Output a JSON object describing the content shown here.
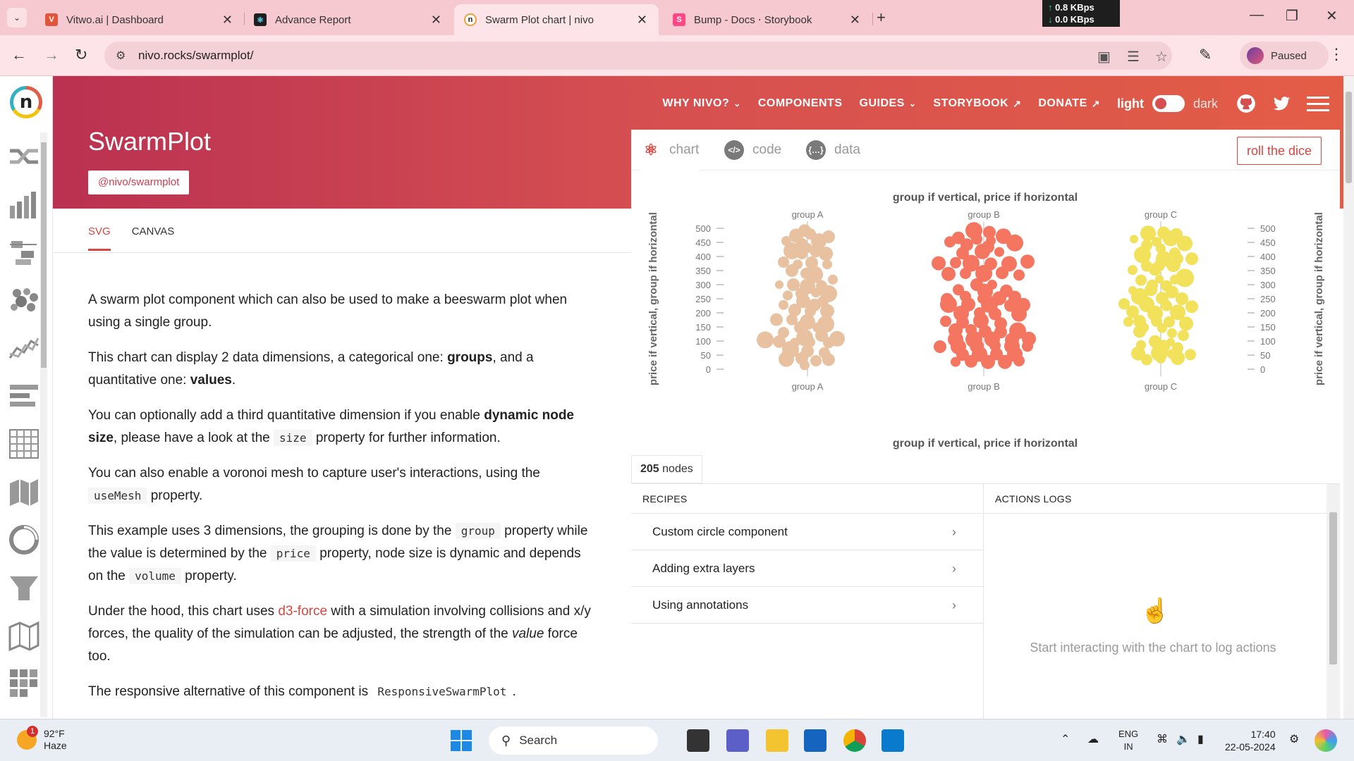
{
  "browser": {
    "tabs": [
      {
        "title": "Vitwo.ai | Dashboard",
        "favicon": "vitwo-icon",
        "color": "#e2553b"
      },
      {
        "title": "Advance Report",
        "favicon": "react-icon",
        "color": "#1f1f1f"
      },
      {
        "title": "Swarm Plot chart | nivo",
        "favicon": "nivo-icon",
        "color": "#e8a33a"
      },
      {
        "title": "Bump - Docs ⋅ Storybook",
        "favicon": "storybook-icon",
        "color": "#ff4785"
      }
    ],
    "active_tab": 2,
    "net_up": "0.8 KBps",
    "net_down": "0.0 KBps",
    "url": "nivo.rocks/swarmplot/",
    "profile_status": "Paused"
  },
  "header": {
    "title": "SwarmPlot",
    "package": "@nivo/swarmplot",
    "nav": [
      {
        "label": "WHY NIVO?",
        "kind": "dropdown"
      },
      {
        "label": "COMPONENTS",
        "kind": "link"
      },
      {
        "label": "GUIDES",
        "kind": "dropdown"
      },
      {
        "label": "STORYBOOK",
        "kind": "external"
      },
      {
        "label": "DONATE",
        "kind": "external"
      }
    ],
    "theme_light": "light",
    "theme_dark": "dark"
  },
  "subtabs": [
    "SVG",
    "CANVAS"
  ],
  "description": {
    "p1": "A swarm plot component which can also be used to make a beeswarm plot when using a single group.",
    "p2a": "This chart can display 2 data dimensions, a categorical one: ",
    "p2b": "groups",
    "p2c": ", and a quantitative one: ",
    "p2d": "values",
    "p2e": ".",
    "p3a": "You can optionally add a third quantitative dimension if you enable ",
    "p3b": "dynamic node size",
    "p3c": ", please have a look at the ",
    "p3d": "size",
    "p3e": " property for further information.",
    "p4a": "You can also enable a voronoi mesh to capture user's interactions, using the ",
    "p4b": "useMesh",
    "p4c": " property.",
    "p5a": "This example uses 3 dimensions, the grouping is done by the ",
    "p5b": "group",
    "p5c": " property while the value is determined by the ",
    "p5d": "price",
    "p5e": " property, node size is dynamic and depends on the ",
    "p5f": "volume",
    "p5g": " property.",
    "p6a": "Under the hood, this chart uses ",
    "p6b": "d3-force",
    "p6c": " with a simulation involving collisions and x/y forces, the quality of the simulation can be adjusted, the strength of the ",
    "p6d": "value",
    "p6e": " force too.",
    "p7a": "The responsive alternative of this component is ",
    "p7b": "ResponsiveSwarmPlot",
    "p7c": "."
  },
  "panel": {
    "tabs": [
      "chart",
      "code",
      "data"
    ],
    "dice": "roll the dice",
    "nodes_count": "205",
    "nodes_label": "nodes"
  },
  "recipes": {
    "heading": "RECIPES",
    "items": [
      "Custom circle component",
      "Adding extra layers",
      "Using annotations"
    ]
  },
  "logs": {
    "heading": "ACTIONS LOGS",
    "empty": "Start interacting with the chart to log actions"
  },
  "chart_data": {
    "type": "scatter",
    "title": "group if vertical, price if horizontal",
    "xlabel": "group if vertical, price if horizontal",
    "ylabel": "price if vertical, group if horizontal",
    "categories": [
      "group A",
      "group B",
      "group C"
    ],
    "y_ticks": [
      0,
      50,
      100,
      150,
      200,
      250,
      300,
      350,
      400,
      450,
      500
    ],
    "ylim": [
      0,
      500
    ],
    "colors": [
      "#e8c1a0",
      "#f47560",
      "#f1e15b"
    ],
    "grid": false,
    "series": [
      {
        "name": "group A",
        "nodes": [
          [
            -4,
            492,
            9
          ],
          [
            -16,
            474,
            10
          ],
          [
            4,
            480,
            8
          ],
          [
            -30,
            455,
            7
          ],
          [
            16,
            455,
            11
          ],
          [
            -8,
            446,
            8
          ],
          [
            30,
            470,
            9
          ],
          [
            0,
            430,
            7
          ],
          [
            -22,
            420,
            12
          ],
          [
            12,
            420,
            9
          ],
          [
            -8,
            410,
            8
          ],
          [
            26,
            410,
            10
          ],
          [
            -34,
            380,
            8
          ],
          [
            -14,
            372,
            7
          ],
          [
            6,
            378,
            9
          ],
          [
            28,
            372,
            7
          ],
          [
            -22,
            350,
            9
          ],
          [
            10,
            336,
            12
          ],
          [
            -2,
            340,
            8
          ],
          [
            36,
            318,
            7
          ],
          [
            -40,
            300,
            6
          ],
          [
            -20,
            300,
            9
          ],
          [
            0,
            294,
            11
          ],
          [
            20,
            296,
            8
          ],
          [
            -8,
            268,
            9
          ],
          [
            12,
            272,
            7
          ],
          [
            30,
            268,
            12
          ],
          [
            -28,
            262,
            7
          ],
          [
            -6,
            242,
            10
          ],
          [
            22,
            240,
            8
          ],
          [
            -34,
            228,
            7
          ],
          [
            10,
            228,
            9
          ],
          [
            -18,
            210,
            9
          ],
          [
            4,
            206,
            8
          ],
          [
            28,
            206,
            10
          ],
          [
            -44,
            176,
            9
          ],
          [
            -22,
            176,
            8
          ],
          [
            0,
            168,
            11
          ],
          [
            26,
            160,
            12
          ],
          [
            -10,
            148,
            9
          ],
          [
            14,
            148,
            7
          ],
          [
            -34,
            130,
            8
          ],
          [
            -4,
            112,
            12
          ],
          [
            20,
            120,
            9
          ],
          [
            42,
            108,
            11
          ],
          [
            -60,
            104,
            12
          ],
          [
            -40,
            98,
            9
          ],
          [
            -18,
            94,
            7
          ],
          [
            4,
            96,
            7
          ],
          [
            30,
            94,
            8
          ],
          [
            -24,
            70,
            12
          ],
          [
            0,
            64,
            9
          ],
          [
            24,
            58,
            8
          ],
          [
            -30,
            36,
            11
          ],
          [
            -8,
            38,
            9
          ],
          [
            12,
            30,
            8
          ],
          [
            30,
            34,
            9
          ],
          [
            -4,
            14,
            7
          ]
        ]
      },
      {
        "name": "group B",
        "nodes": [
          [
            -14,
            492,
            12
          ],
          [
            8,
            486,
            9
          ],
          [
            28,
            472,
            11
          ],
          [
            -36,
            466,
            9
          ],
          [
            -10,
            462,
            8
          ],
          [
            10,
            456,
            7
          ],
          [
            44,
            448,
            12
          ],
          [
            -48,
            452,
            8
          ],
          [
            -24,
            442,
            9
          ],
          [
            6,
            434,
            9
          ],
          [
            -2,
            418,
            11
          ],
          [
            -30,
            412,
            9
          ],
          [
            22,
            416,
            7
          ],
          [
            -64,
            376,
            10
          ],
          [
            -40,
            378,
            8
          ],
          [
            -18,
            376,
            12
          ],
          [
            10,
            374,
            9
          ],
          [
            36,
            374,
            11
          ],
          [
            62,
            382,
            10
          ],
          [
            -50,
            338,
            10
          ],
          [
            -26,
            340,
            8
          ],
          [
            0,
            340,
            12
          ],
          [
            26,
            342,
            9
          ],
          [
            50,
            334,
            8
          ],
          [
            -10,
            300,
            9
          ],
          [
            12,
            300,
            7
          ],
          [
            -36,
            282,
            8
          ],
          [
            2,
            276,
            11
          ],
          [
            32,
            278,
            9
          ],
          [
            -52,
            248,
            9
          ],
          [
            -26,
            258,
            8
          ],
          [
            -2,
            250,
            7
          ],
          [
            22,
            252,
            10
          ],
          [
            44,
            256,
            9
          ],
          [
            -50,
            230,
            12
          ],
          [
            -22,
            230,
            10
          ],
          [
            8,
            230,
            12
          ],
          [
            38,
            226,
            9
          ],
          [
            56,
            228,
            10
          ],
          [
            -32,
            198,
            11
          ],
          [
            -6,
            200,
            8
          ],
          [
            16,
            196,
            9
          ],
          [
            50,
            196,
            11
          ],
          [
            -54,
            170,
            8
          ],
          [
            -30,
            166,
            9
          ],
          [
            -4,
            172,
            11
          ],
          [
            24,
            162,
            9
          ],
          [
            -40,
            138,
            10
          ],
          [
            -18,
            140,
            8
          ],
          [
            2,
            134,
            9
          ],
          [
            24,
            132,
            9
          ],
          [
            48,
            136,
            12
          ],
          [
            -40,
            106,
            11
          ],
          [
            -14,
            106,
            12
          ],
          [
            12,
            106,
            11
          ],
          [
            40,
            104,
            10
          ],
          [
            64,
            108,
            10
          ],
          [
            -62,
            80,
            9
          ],
          [
            -36,
            80,
            11
          ],
          [
            -10,
            82,
            10
          ],
          [
            16,
            84,
            8
          ],
          [
            40,
            82,
            11
          ],
          [
            62,
            82,
            8
          ],
          [
            -30,
            52,
            9
          ],
          [
            -6,
            54,
            11
          ],
          [
            18,
            54,
            9
          ],
          [
            44,
            54,
            11
          ],
          [
            -18,
            28,
            9
          ],
          [
            6,
            26,
            10
          ],
          [
            30,
            26,
            10
          ],
          [
            50,
            30,
            8
          ],
          [
            -40,
            26,
            7
          ]
        ]
      },
      {
        "name": "group C",
        "nodes": [
          [
            -18,
            482,
            11
          ],
          [
            4,
            484,
            9
          ],
          [
            22,
            478,
            9
          ],
          [
            -38,
            462,
            6
          ],
          [
            -6,
            452,
            7
          ],
          [
            14,
            464,
            11
          ],
          [
            34,
            446,
            11
          ],
          [
            -20,
            440,
            8
          ],
          [
            0,
            428,
            7
          ],
          [
            -26,
            406,
            12
          ],
          [
            20,
            412,
            8
          ],
          [
            44,
            392,
            9
          ],
          [
            4,
            392,
            11
          ],
          [
            24,
            392,
            8
          ],
          [
            -20,
            366,
            8
          ],
          [
            -2,
            368,
            8
          ],
          [
            18,
            370,
            10
          ],
          [
            -40,
            352,
            7
          ],
          [
            -8,
            354,
            9
          ],
          [
            34,
            324,
            13
          ],
          [
            -28,
            316,
            8
          ],
          [
            -2,
            320,
            6
          ],
          [
            20,
            318,
            7
          ],
          [
            -12,
            298,
            8
          ],
          [
            8,
            296,
            8
          ],
          [
            -40,
            280,
            6
          ],
          [
            -14,
            282,
            9
          ],
          [
            16,
            274,
            9
          ],
          [
            -30,
            258,
            12
          ],
          [
            2,
            252,
            9
          ],
          [
            30,
            250,
            9
          ],
          [
            -52,
            232,
            8
          ],
          [
            -20,
            230,
            11
          ],
          [
            8,
            226,
            8
          ],
          [
            44,
            222,
            9
          ],
          [
            -40,
            204,
            9
          ],
          [
            -8,
            198,
            11
          ],
          [
            24,
            202,
            11
          ],
          [
            -30,
            170,
            9
          ],
          [
            -6,
            170,
            8
          ],
          [
            12,
            168,
            8
          ],
          [
            36,
            162,
            10
          ],
          [
            -46,
            168,
            7
          ],
          [
            -24,
            148,
            7
          ],
          [
            2,
            146,
            7
          ],
          [
            -30,
            134,
            9
          ],
          [
            16,
            128,
            7
          ],
          [
            32,
            120,
            8
          ],
          [
            -8,
            98,
            9
          ],
          [
            14,
            96,
            6
          ],
          [
            -28,
            86,
            7
          ],
          [
            4,
            82,
            9
          ],
          [
            24,
            76,
            8
          ],
          [
            -32,
            56,
            10
          ],
          [
            -2,
            58,
            12
          ],
          [
            16,
            54,
            7
          ],
          [
            42,
            52,
            8
          ],
          [
            -20,
            34,
            8
          ],
          [
            0,
            38,
            7
          ],
          [
            24,
            40,
            10
          ]
        ]
      }
    ]
  }
}
